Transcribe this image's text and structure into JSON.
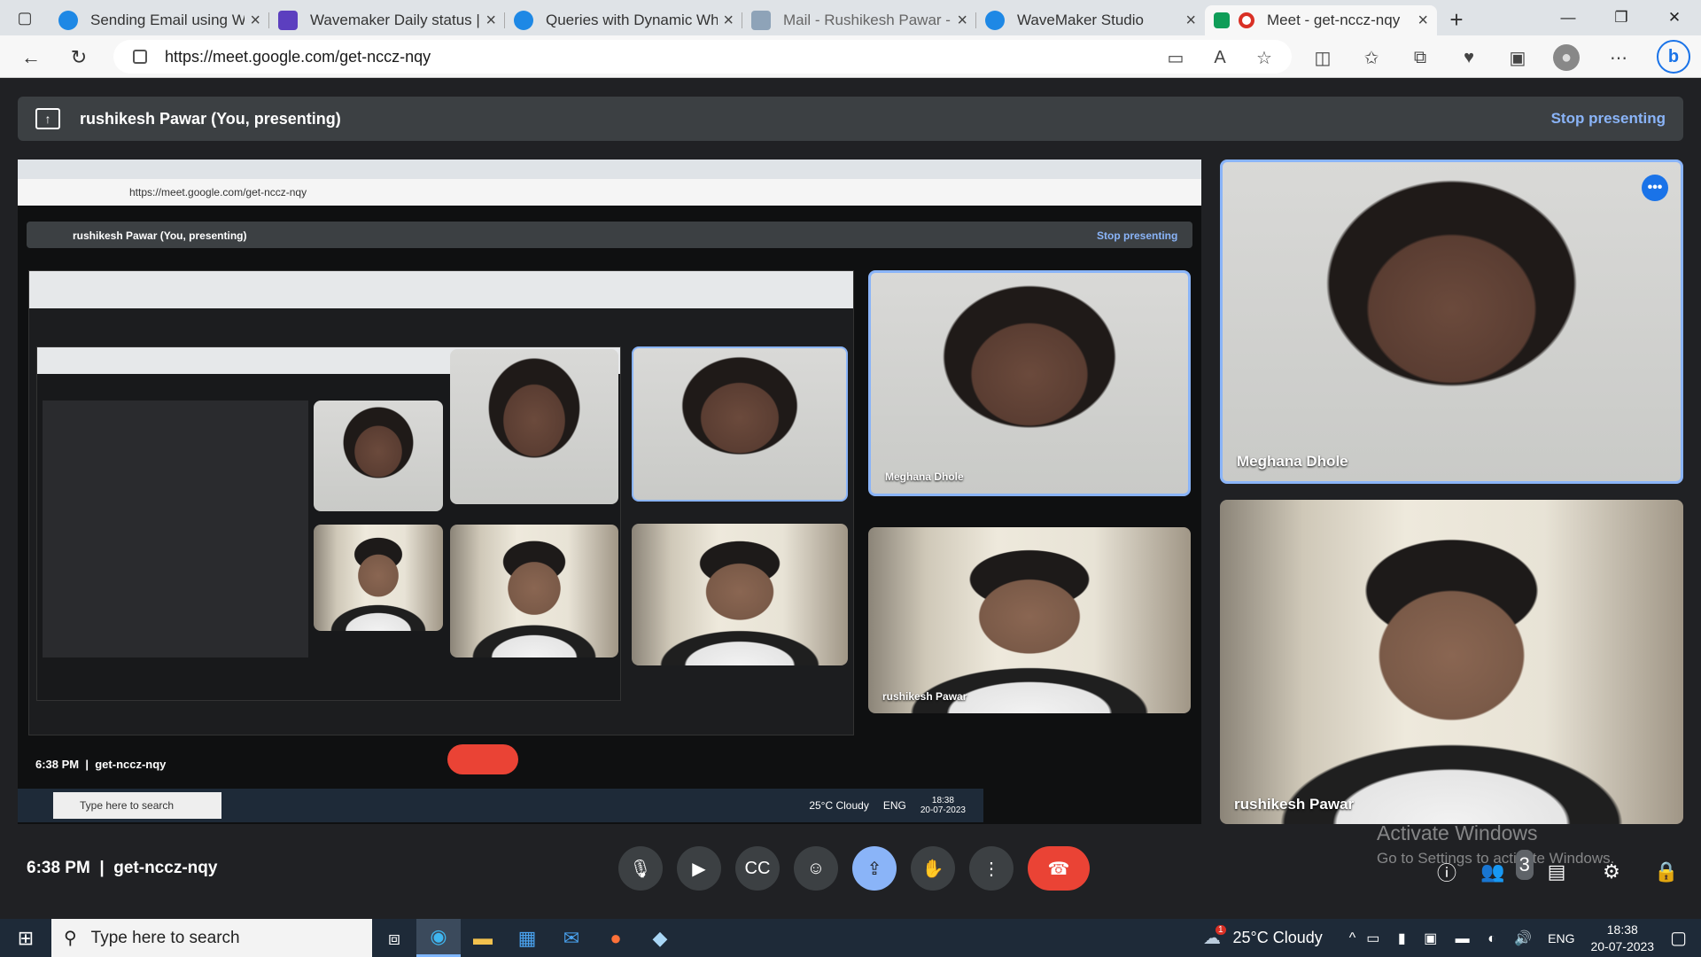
{
  "browser": {
    "tabs": [
      {
        "title": "Sending Email using WaveM",
        "icon_color": "#1e88e5"
      },
      {
        "title": "Wavemaker Daily status | M",
        "icon_color": "#5c3fbf"
      },
      {
        "title": "Queries with Dynamic Wher",
        "icon_color": "#1e88e5"
      },
      {
        "title": "Mail - Rushikesh Pawar - Ou",
        "icon_color": "#8ea3b8"
      },
      {
        "title": "WaveMaker Studio",
        "icon_color": "#1e88e5"
      },
      {
        "title": "Meet - get-nccz-nqy",
        "icon_color": "#0f9d58",
        "active": true
      }
    ],
    "url": "https://meet.google.com/get-nccz-nqy"
  },
  "meet": {
    "presenter_text": "rushikesh Pawar (You, presenting)",
    "stop_presenting": "Stop presenting",
    "participants": [
      {
        "name": "Meghana Dhole"
      },
      {
        "name": "rushikesh Pawar"
      }
    ],
    "time": "6:38 PM",
    "meeting_code": "get-nccz-nqy",
    "people_count": "3",
    "watermark_title": "Activate Windows",
    "watermark_sub": "Go to Settings to activate Windows."
  },
  "nested": {
    "presenter_text": "rushikesh Pawar (You, presenting)",
    "stop_presenting": "Stop presenting",
    "url": "https://meet.google.com/get-nccz-nqy",
    "time": "6:38 PM",
    "meeting_code": "get-nccz-nqy",
    "name_a": "Meghana Dhole",
    "name_b": "rushikesh Pawar",
    "search": "Type here to search",
    "weather": "25°C  Cloudy",
    "lang": "ENG",
    "clock": "18:38",
    "date": "20-07-2023"
  },
  "taskbar": {
    "search_placeholder": "Type here to search",
    "weather": "25°C  Cloudy",
    "weather_badge": "1",
    "lang": "ENG",
    "time": "18:38",
    "date": "20-07-2023"
  }
}
